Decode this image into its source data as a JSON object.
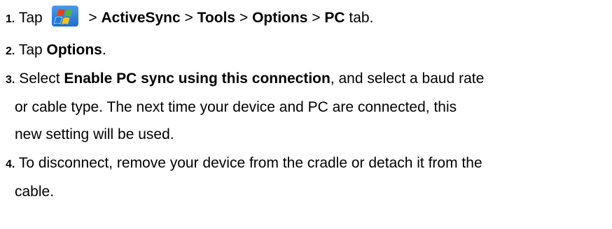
{
  "steps": [
    {
      "number": "1.",
      "parts": {
        "tap": "Tap",
        "sep1": ">",
        "activesync": "ActiveSync",
        "sep2": ">",
        "tools": "Tools",
        "sep3": ">",
        "options": "Options",
        "sep4": ">",
        "pc": "PC",
        "tab": "tab."
      },
      "icon": "windows-start-flag-icon"
    },
    {
      "number": "2.",
      "parts": {
        "tap": "Tap",
        "options": "Options",
        "period": "."
      }
    },
    {
      "number": "3.",
      "parts": {
        "select": "Select",
        "enable": "Enable PC sync using this connection",
        "rest1": ", and select a baud rate",
        "line2": "or cable type. The next time your device and PC are connected, this",
        "line3": "new setting will be used."
      }
    },
    {
      "number": "4.",
      "parts": {
        "line1": "To disconnect, remove your device from the cradle or detach it from the",
        "line2": "cable."
      }
    }
  ],
  "colors": {
    "text": "#000000",
    "flag_red": "#e8401c",
    "flag_green": "#58b52a",
    "flag_blue": "#1a7ad6",
    "flag_yellow": "#f6c21a",
    "icon_bg": "#1f6fd0"
  }
}
